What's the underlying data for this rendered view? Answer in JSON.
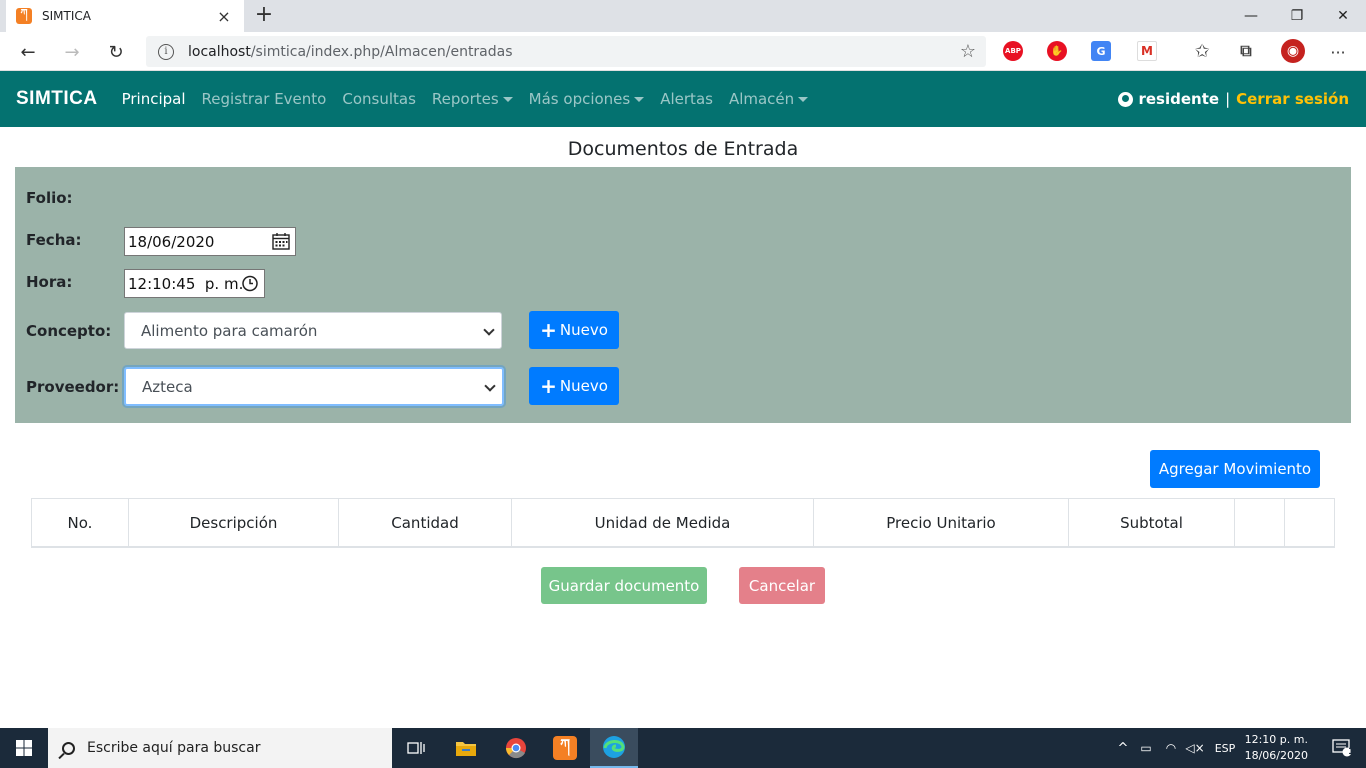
{
  "browser": {
    "tab_title": "SIMTICA",
    "favicon_text": "ཀ",
    "close_tab": "×",
    "new_tab": "+",
    "minimize": "—",
    "restore": "❐",
    "close_window": "✕",
    "back": "←",
    "forward": "→",
    "reload": "↻",
    "url_host": "localhost",
    "url_path": "/simtica/index.php/Almacen/entradas",
    "star": "☆",
    "more": "···",
    "extensions": [
      {
        "name": "adblock-plus",
        "label": "ABP",
        "color": "#e81123"
      },
      {
        "name": "stop",
        "label": "✋",
        "color": "#e81123"
      },
      {
        "name": "translate",
        "label": "G",
        "color": "#4285f4"
      },
      {
        "name": "gmail",
        "label": "M",
        "color": "#d93025"
      },
      {
        "name": "favorites",
        "label": "✩",
        "color": "#555555"
      },
      {
        "name": "collections",
        "label": "⧉",
        "color": "#555555"
      },
      {
        "name": "profile",
        "label": "◉",
        "color": "#c5221f"
      }
    ]
  },
  "navbar": {
    "brand": "SIMTICA",
    "links": [
      {
        "label": "Principal",
        "active": true,
        "dropdown": false
      },
      {
        "label": "Registrar Evento",
        "active": false,
        "dropdown": false
      },
      {
        "label": "Consultas",
        "active": false,
        "dropdown": false
      },
      {
        "label": "Reportes",
        "active": false,
        "dropdown": true
      },
      {
        "label": "Más opciones",
        "active": false,
        "dropdown": true
      },
      {
        "label": "Alertas",
        "active": false,
        "dropdown": false
      },
      {
        "label": "Almacén",
        "active": false,
        "dropdown": true
      }
    ],
    "user": "residente",
    "separator": "|",
    "logout": "Cerrar sesión"
  },
  "page": {
    "title": "Documentos de Entrada",
    "form": {
      "folio_label": "Folio:",
      "fecha_label": "Fecha:",
      "fecha_value": "18/06/2020",
      "hora_label": "Hora:",
      "hora_value": "12:10:45  p. m.",
      "concepto_label": "Concepto:",
      "concepto_value": "Alimento para camarón",
      "proveedor_label": "Proveedor:",
      "proveedor_value": "Azteca",
      "nuevo_label": "Nuevo"
    },
    "add_movement": "Agregar Movimiento",
    "table_headers": [
      "No.",
      "Descripción",
      "Cantidad",
      "Unidad de Medida",
      "Precio Unitario",
      "Subtotal",
      "",
      ""
    ],
    "save_button": "Guardar documento",
    "cancel_button": "Cancelar"
  },
  "taskbar": {
    "search_placeholder": "Escribe aquí para buscar",
    "language": "ESP",
    "time": "12:10 p. m.",
    "date": "18/06/2020",
    "notification_count": "1"
  },
  "colors": {
    "navbar": "#047270",
    "panel": "#9bb3a9",
    "primary": "#007bff",
    "success": "#77c58b",
    "danger": "#e4808a",
    "logout": "#ffc107"
  }
}
